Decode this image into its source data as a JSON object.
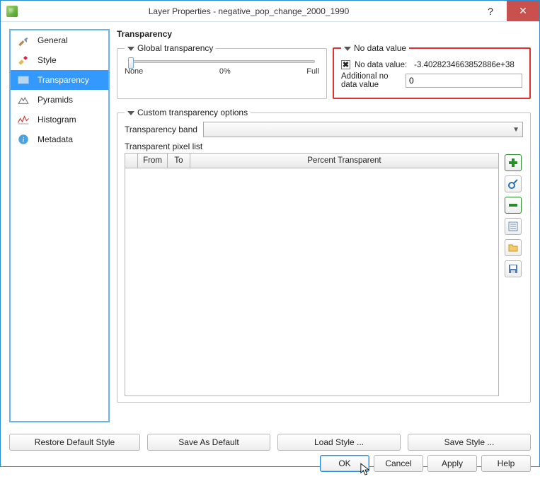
{
  "titlebar": {
    "title": "Layer Properties - negative_pop_change_2000_1990",
    "help_glyph": "?",
    "close_glyph": "✕"
  },
  "sidebar": {
    "items": [
      {
        "label": "General"
      },
      {
        "label": "Style"
      },
      {
        "label": "Transparency"
      },
      {
        "label": "Pyramids"
      },
      {
        "label": "Histogram"
      },
      {
        "label": "Metadata"
      }
    ]
  },
  "main": {
    "section_title": "Transparency",
    "global": {
      "legend": "Global transparency",
      "none": "None",
      "percent": "0%",
      "full": "Full"
    },
    "nodata": {
      "legend": "No data value",
      "label": "No data value:",
      "value": "-3.4028234663852886e+38",
      "additional_label": "Additional no data value",
      "additional_value": "0"
    },
    "custom": {
      "legend": "Custom transparency options",
      "band_label": "Transparency band",
      "list_label": "Transparent pixel list",
      "columns": {
        "from": "From",
        "to": "To",
        "pt": "Percent Transparent"
      }
    }
  },
  "style_buttons": {
    "restore": "Restore Default Style",
    "save_default": "Save As Default",
    "load": "Load Style ...",
    "save": "Save Style ..."
  },
  "dialog_buttons": {
    "ok": "OK",
    "cancel": "Cancel",
    "apply": "Apply",
    "help": "Help"
  },
  "tool_icons": [
    "add-icon",
    "pick-icon",
    "remove-icon",
    "default-icon",
    "import-icon",
    "export-icon"
  ]
}
